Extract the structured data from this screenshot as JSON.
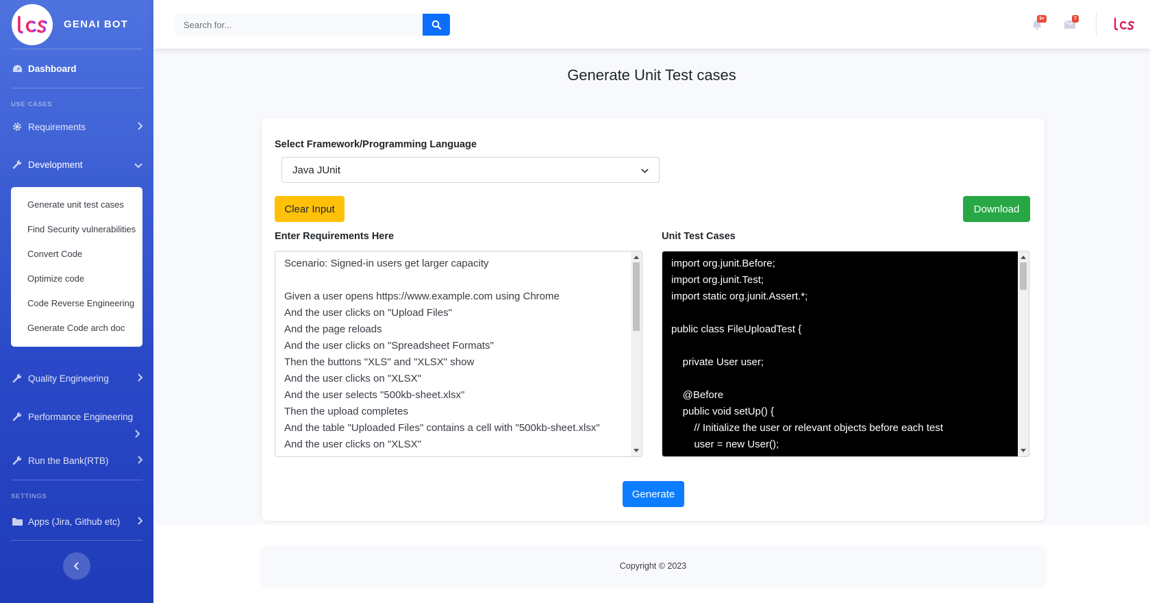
{
  "brand": {
    "name": "GENAI BOT",
    "logo_text": "tcs"
  },
  "sidebar": {
    "dashboard": "Dashboard",
    "section_use_cases": "USE CASES",
    "requirements": "Requirements",
    "development": "Development",
    "development_items": [
      "Generate unit test cases",
      "Find Security vulnerabilities",
      "Convert Code",
      "Optimize code",
      "Code Reverse Engineering",
      "Generate Code arch doc"
    ],
    "quality": "Quality Engineering",
    "performance": "Performance Engineering",
    "rtb": "Run the Bank(RTB)",
    "section_settings": "SETTINGS",
    "apps": "Apps (Jira, Github etc)"
  },
  "topbar": {
    "search_placeholder": "Search for...",
    "alerts_badge": "3+",
    "messages_badge": "7",
    "logo_text": "tcs"
  },
  "page": {
    "title": "Generate Unit Test cases",
    "framework_label": "Select Framework/Programming Language",
    "framework_value": "Java JUnit",
    "clear_button": "Clear Input",
    "download_button": "Download",
    "requirements_label": "Enter Requirements Here",
    "tests_label": "Unit Test Cases",
    "requirements_text": "Scenario: Signed-in users get larger capacity\n\nGiven a user opens https://www.example.com using Chrome\nAnd the user clicks on \"Upload Files\"\nAnd the page reloads\nAnd the user clicks on \"Spreadsheet Formats\"\nThen the buttons \"XLS\" and \"XLSX\" show\nAnd the user clicks on \"XLSX\"\nAnd the user selects \"500kb-sheet.xlsx\"\nThen the upload completes\nAnd the table \"Uploaded Files\" contains a cell with \"500kb-sheet.xlsx\"\nAnd the user clicks on \"XLSX\"",
    "tests_text": "import org.junit.Before;\nimport org.junit.Test;\nimport static org.junit.Assert.*;\n\npublic class FileUploadTest {\n\n    private User user;\n\n    @Before\n    public void setUp() {\n        // Initialize the user or relevant objects before each test\n        user = new User();",
    "generate_button": "Generate"
  },
  "footer": {
    "copyright": "Copyright © 2023"
  },
  "colors": {
    "sidebar": "#4e73df",
    "primary": "#0d7dff",
    "success": "#28a745",
    "warning": "#ffc107",
    "badge": "#e74a3b"
  }
}
